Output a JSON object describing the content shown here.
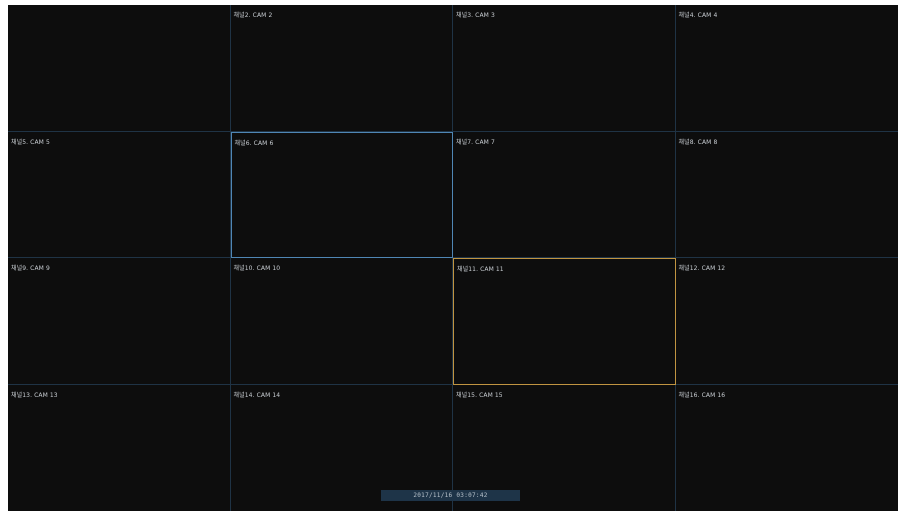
{
  "channels": [
    {
      "label": ""
    },
    {
      "label": "채널2. CAM 2"
    },
    {
      "label": "채널3. CAM 3"
    },
    {
      "label": "채널4. CAM 4"
    },
    {
      "label": "채널5. CAM 5"
    },
    {
      "label": "채널6. CAM 6"
    },
    {
      "label": "채널7. CAM 7"
    },
    {
      "label": "채널8. CAM 8"
    },
    {
      "label": "채널9. CAM 9"
    },
    {
      "label": "채널10. CAM 10"
    },
    {
      "label": "채널11. CAM 11"
    },
    {
      "label": "채널12. CAM 12"
    },
    {
      "label": "채널13. CAM 13"
    },
    {
      "label": "채널14. CAM 14"
    },
    {
      "label": "채널15. CAM 15"
    },
    {
      "label": "채널16. CAM 16"
    }
  ],
  "selection": {
    "blue_channel": 6,
    "orange_channel": 11,
    "blue_color": "#4f86b4",
    "orange_color": "#c09441"
  },
  "timestamp": "2017/11/16 03:07:42"
}
